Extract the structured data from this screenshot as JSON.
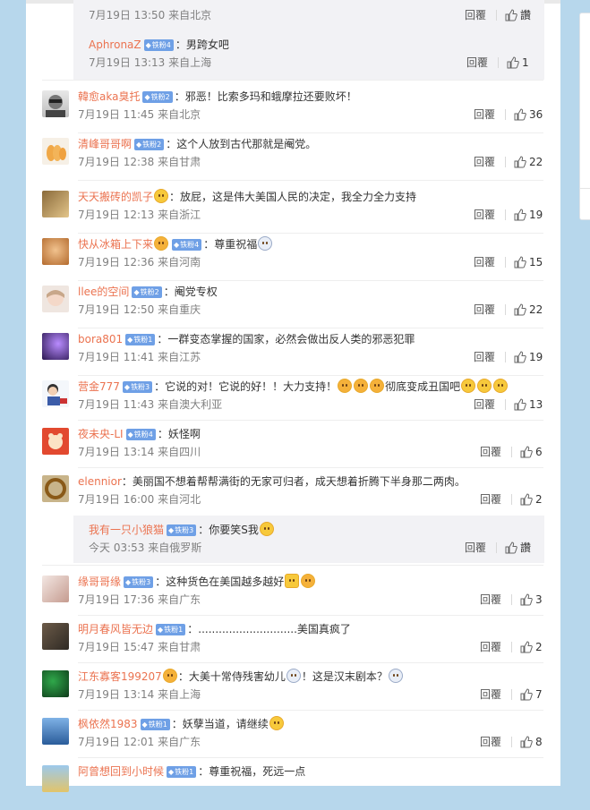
{
  "colors": {
    "username": "#eb7350",
    "badge": "#6fa0e6",
    "page_bg": "#b7d7ec"
  },
  "actions": {
    "reply_label": "回覆",
    "like_icon": "thumbs-up-icon"
  },
  "comments": [
    {
      "user": "",
      "badge": "",
      "text": "",
      "time": "7月19日 13:50 来自北京",
      "likes": "讚",
      "sub": true
    },
    {
      "user": "AphronaZ",
      "badge": "铁粉4",
      "text": "：男跨女吧",
      "time": "7月19日 13:13 来自上海",
      "likes": "1",
      "sub": true
    },
    {
      "user": "韓愈aka臭托",
      "badge": "铁粉2",
      "text": "：邪恶！比索多玛和蛾摩拉还要败坏！",
      "time": "7月19日 11:45 来自北京",
      "likes": "36"
    },
    {
      "user": "清峰哥哥啊",
      "badge": "铁粉2",
      "text": "：这个人放到古代那就是阉党。",
      "time": "7月19日 12:38 来自甘肃",
      "likes": "22"
    },
    {
      "user": "天天搬砖的凯子",
      "badge": "",
      "text": "：放屁，这是伟大美国人民的决定，我全力全力支持",
      "time": "7月19日 12:13 来自浙江",
      "likes": "19"
    },
    {
      "user": "快从冰箱上下来",
      "badge": "铁粉4",
      "text": "：尊重祝福",
      "time": "7月19日 12:36 来自河南",
      "likes": "15"
    },
    {
      "user": "llee的空间",
      "badge": "铁粉2",
      "text": "：阉党专权",
      "time": "7月19日 12:50 来自重庆",
      "likes": "22"
    },
    {
      "user": "bora801",
      "badge": "铁粉1",
      "text": "：一群变态掌握的国家，必然会做出反人类的邪恶犯罪",
      "time": "7月19日 11:41 来自江苏",
      "likes": "19"
    },
    {
      "user": "营金777",
      "badge": "铁粉3",
      "text": "：它说的对！它说的好！！大力支持！",
      "text2": "彻底变成丑国吧",
      "time": "7月19日 11:43 来自澳大利亚",
      "likes": "13"
    },
    {
      "user": "夜未央-LI",
      "badge": "铁粉4",
      "text": "：妖怪啊",
      "time": "7月19日 13:14 来自四川",
      "likes": "6"
    },
    {
      "user": "elennior",
      "badge": "",
      "text": "：美丽国不想着帮帮满街的无家可归者，成天想着折腾下半身那二两肉。",
      "time": "7月19日 16:00 来自河北",
      "likes": "2"
    },
    {
      "user": "我有一只小狼猫",
      "badge": "铁粉3",
      "text": "：你要笑S我",
      "time": "今天 03:53 来自俄罗斯",
      "likes": "讚",
      "sub": true
    },
    {
      "user": "缘哥哥缘",
      "badge": "铁粉3",
      "text": "：这种货色在美国越多越好",
      "time": "7月19日 17:36 来自广东",
      "likes": "3"
    },
    {
      "user": "明月春风皆无边",
      "badge": "铁粉1",
      "text": "：.............................美国真疯了",
      "time": "7月19日 15:47 来自甘肃",
      "likes": "2"
    },
    {
      "user": "江东寡客199207",
      "badge": "",
      "text": "：大美十常侍残害幼儿",
      "text2": "！这是汉末剧本？",
      "time": "7月19日 13:14 来自上海",
      "likes": "7"
    },
    {
      "user": "枫依然1983",
      "badge": "铁粉1",
      "text": "：妖孽当道，请继续",
      "time": "7月19日 12:01 来自广东",
      "likes": "8"
    },
    {
      "user": "阿曾想回到小时候",
      "badge": "铁粉1",
      "text": "：尊重祝福，死远一点",
      "time": "",
      "likes": ""
    }
  ]
}
